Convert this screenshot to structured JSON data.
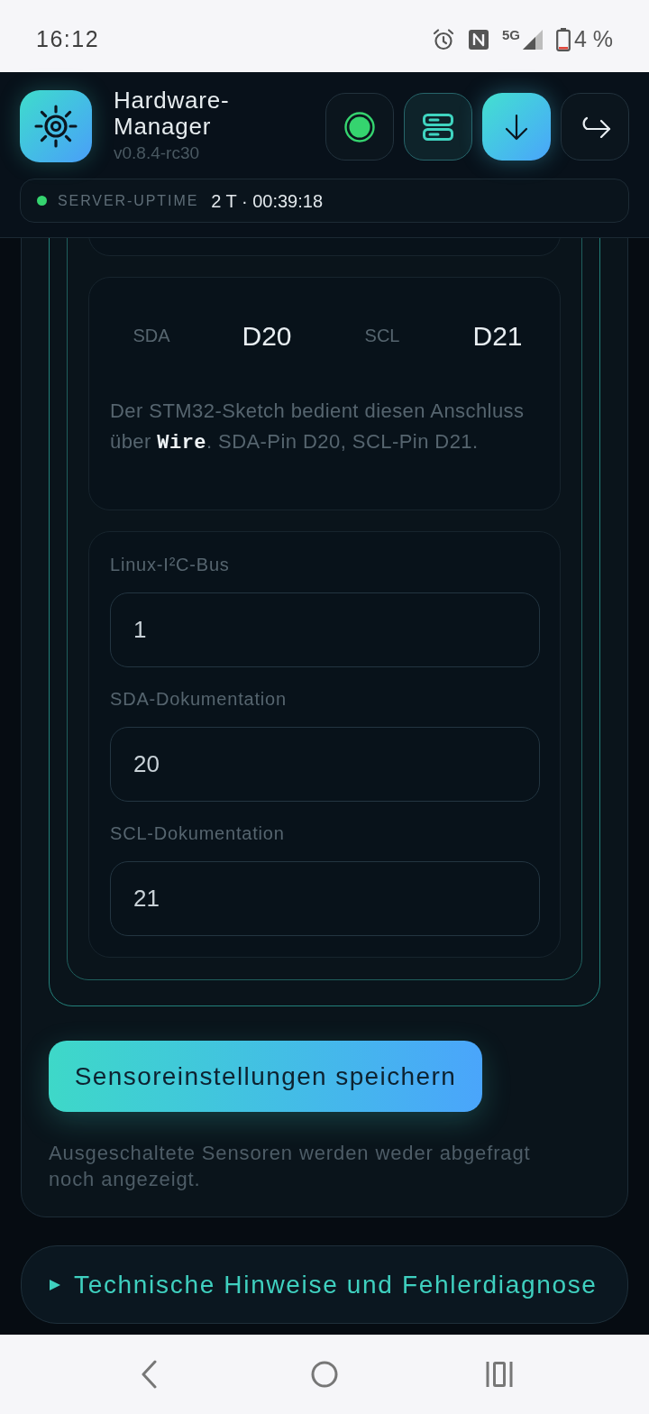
{
  "status_bar": {
    "time": "16:12",
    "network": "5G",
    "battery": "4 %"
  },
  "header": {
    "title": "Hardware-Manager",
    "version": "v0.8.4-rc30",
    "actions": [
      {
        "kind": "status"
      },
      {
        "kind": "servers"
      },
      {
        "kind": "download"
      },
      {
        "kind": "exit"
      }
    ],
    "uptime": {
      "label": "SERVER-UPTIME",
      "value": "2 T · 00:39:18",
      "online": true
    }
  },
  "bus_card": {
    "pins": [
      {
        "label": "SDA",
        "value": "D20"
      },
      {
        "label": "SCL",
        "value": "D21"
      }
    ],
    "description": "Der STM32-Sketch bedient diesen Anschluss über **Wire**. SDA-Pin D20, SCL-Pin D21."
  },
  "fields": [
    {
      "label": "Linux-I²C-Bus",
      "value": "1"
    },
    {
      "label": "SDA-Dokumentation",
      "value": "20"
    },
    {
      "label": "SCL-Dokumentation",
      "value": "21"
    }
  ],
  "save_button": "Sensoreinstellungen speichern",
  "note": "Ausgeschaltete Sensoren werden weder abgefragt noch angezeigt.",
  "details": {
    "label": "Technische Hinweise und Fehlerdiagnose",
    "expanded": false
  }
}
